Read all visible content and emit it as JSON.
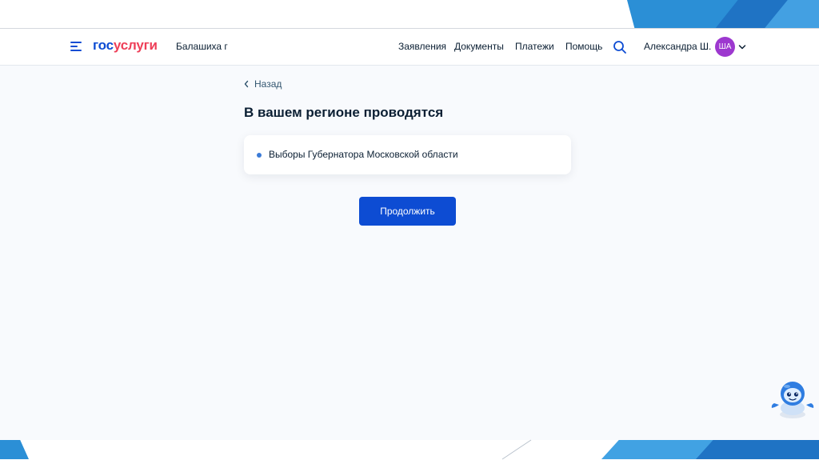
{
  "header": {
    "logo": {
      "gos": "гос",
      "uslugi": "услуги"
    },
    "region": "Балашиха г",
    "nav": [
      {
        "label": "Заявления"
      },
      {
        "label": "Документы"
      },
      {
        "label": "Платежи"
      },
      {
        "label": "Помощь"
      }
    ],
    "user": {
      "name": "Александра Ш.",
      "initials": "ША"
    }
  },
  "content": {
    "back_label": "Назад",
    "title": "В вашем регионе проводятся",
    "items": [
      "Выборы Губернатора Московской области"
    ],
    "continue_label": "Продолжить"
  },
  "colors": {
    "brand_blue": "#0d4cd3",
    "brand_red": "#ee3f58",
    "avatar": "#9d38cf",
    "page_background": "#f8fafd"
  },
  "icons": [
    "burger-menu-icon",
    "search-icon",
    "chevron-down-icon",
    "chevron-left-icon",
    "robot-assistant-icon"
  ]
}
